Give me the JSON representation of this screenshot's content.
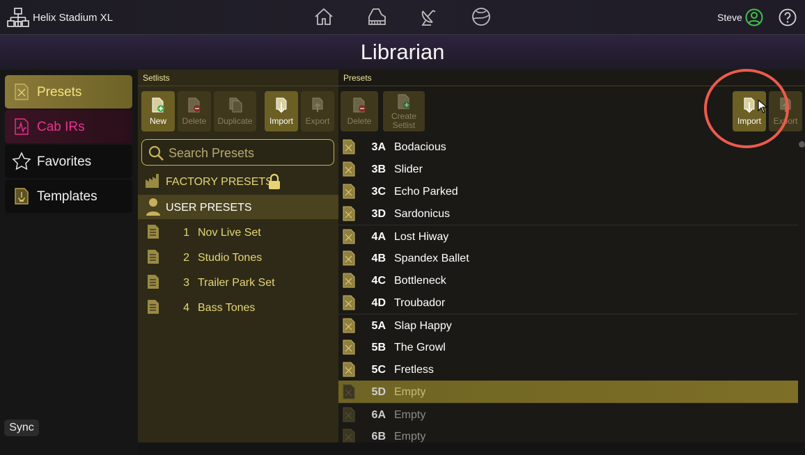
{
  "topbar": {
    "device_name": "Helix Stadium XL",
    "user_name": "Steve",
    "icons": [
      "network-icon",
      "home-icon",
      "piano-icon",
      "satellite-dish-icon",
      "globe-icon",
      "user-circle-icon",
      "help-icon"
    ]
  },
  "page_title": "Librarian",
  "sidebar": {
    "items": [
      {
        "label": "Presets",
        "icon": "preset-icon"
      },
      {
        "label": "Cab IRs",
        "icon": "impulse-icon"
      },
      {
        "label": "Favorites",
        "icon": "star-icon"
      },
      {
        "label": "Templates",
        "icon": "template-icon"
      }
    ],
    "sync_label": "Sync"
  },
  "setlists": {
    "header": "Setlists",
    "toolbar": {
      "new": "New",
      "delete": "Delete",
      "duplicate": "Duplicate",
      "import": "Import",
      "export": "Export"
    },
    "search_placeholder": "Search Presets",
    "factory_label": "FACTORY PRESETS",
    "user_label": "USER PRESETS",
    "items": [
      {
        "num": "1",
        "name": "Nov Live Set"
      },
      {
        "num": "2",
        "name": "Studio Tones"
      },
      {
        "num": "3",
        "name": "Trailer Park Set"
      },
      {
        "num": "4",
        "name": "Bass Tones"
      }
    ]
  },
  "presets": {
    "header": "Presets",
    "toolbar": {
      "delete": "Delete",
      "create_setlist": "Create Setlist",
      "import": "Import",
      "export": "Export"
    },
    "items": [
      {
        "id": "3A",
        "name": "Bodacious"
      },
      {
        "id": "3B",
        "name": "Slider"
      },
      {
        "id": "3C",
        "name": "Echo Parked"
      },
      {
        "id": "3D",
        "name": "Sardonicus"
      },
      {
        "id": "4A",
        "name": "Lost Hiway"
      },
      {
        "id": "4B",
        "name": "Spandex Ballet"
      },
      {
        "id": "4C",
        "name": "Bottleneck"
      },
      {
        "id": "4D",
        "name": "Troubador"
      },
      {
        "id": "5A",
        "name": "Slap Happy"
      },
      {
        "id": "5B",
        "name": "The Growl"
      },
      {
        "id": "5C",
        "name": "Fretless"
      },
      {
        "id": "5D",
        "name": "Empty"
      },
      {
        "id": "6A",
        "name": "Empty"
      },
      {
        "id": "6B",
        "name": "Empty"
      }
    ]
  },
  "colors": {
    "accent_gold": "#6b5f24",
    "label_gold": "#e7d574",
    "cab_pink": "#e8338e",
    "highlight_red": "#ee5a4c",
    "user_green": "#3ec24a"
  }
}
